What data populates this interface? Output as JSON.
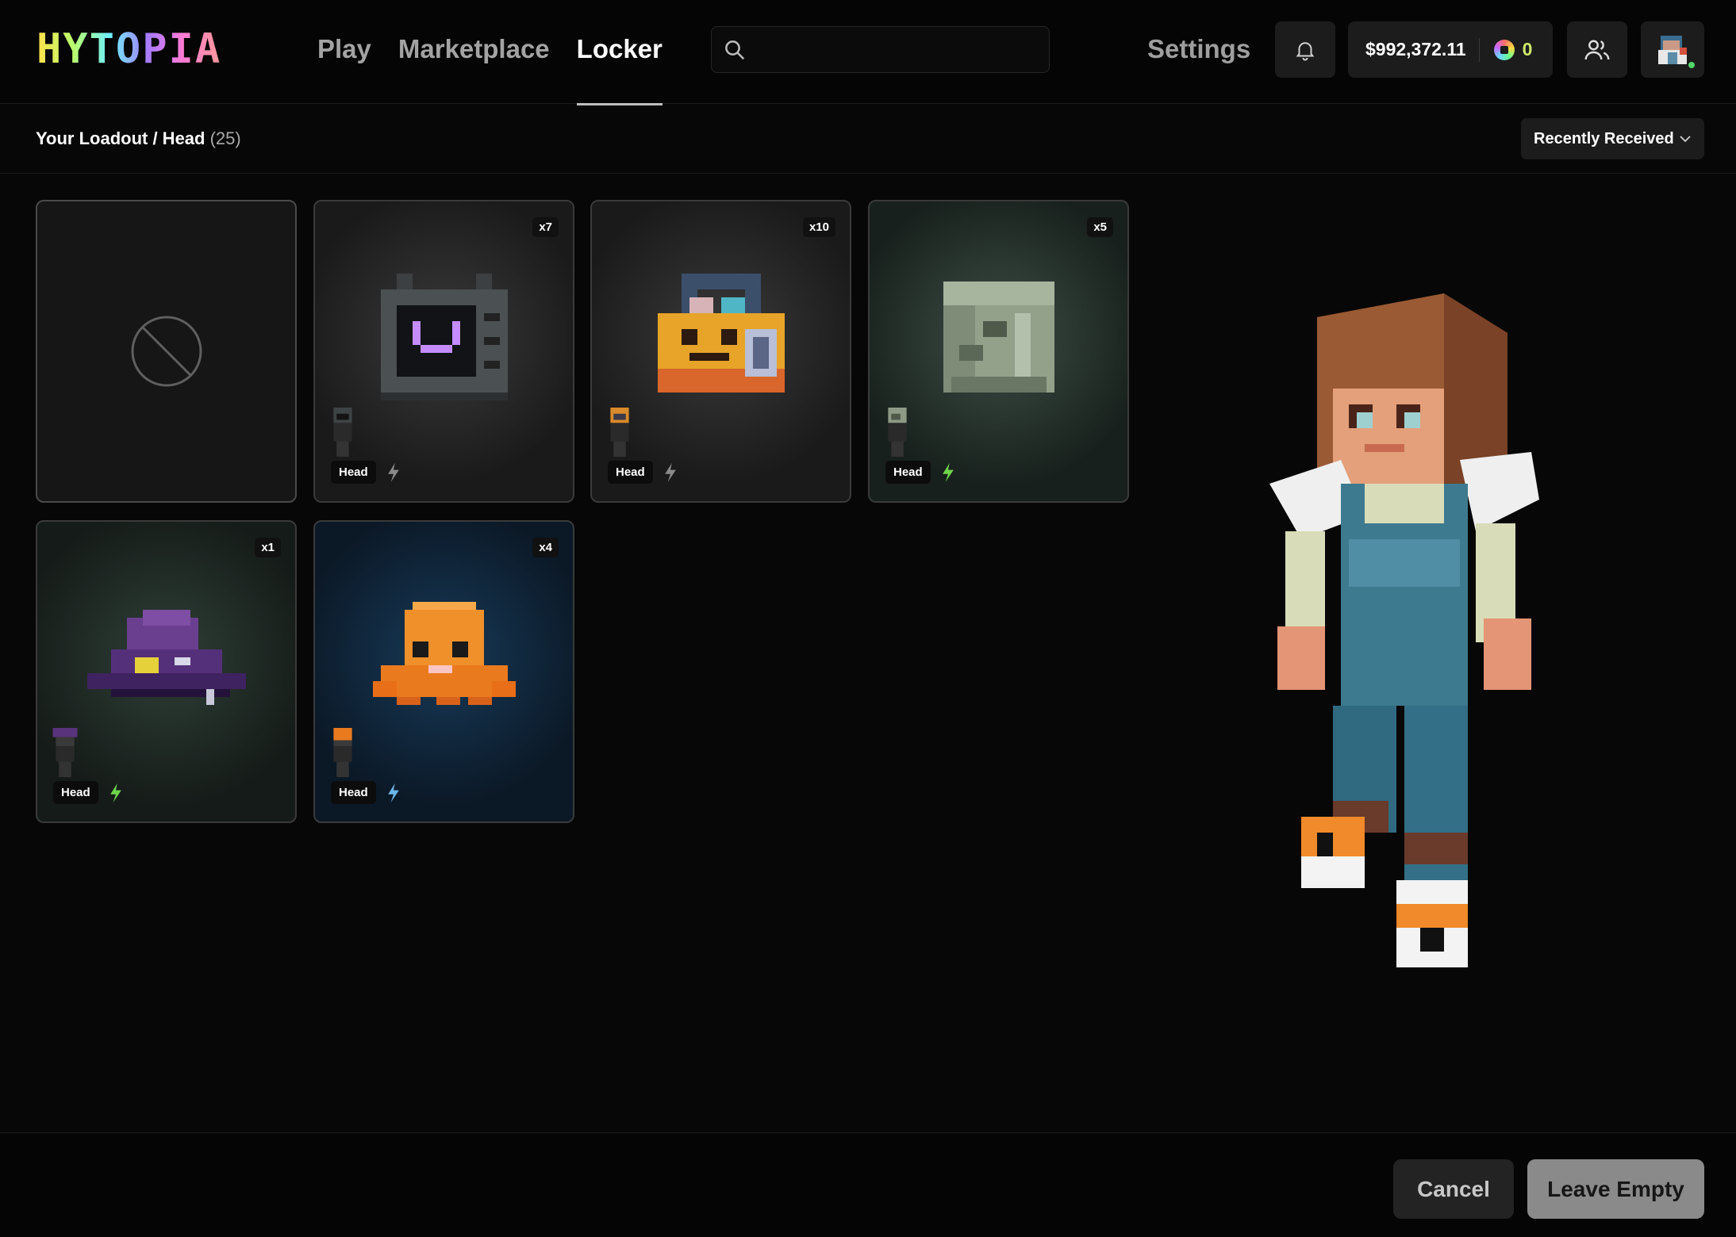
{
  "header": {
    "logo_text": "HYTOPIA",
    "nav": [
      {
        "label": "Play",
        "active": false
      },
      {
        "label": "Marketplace",
        "active": false
      },
      {
        "label": "Locker",
        "active": true
      }
    ],
    "search": {
      "placeholder": "",
      "value": "",
      "icon": "search-icon"
    },
    "settings_label": "Settings",
    "notifications_icon": "bell-icon",
    "wallet": {
      "balance": "$992,372.11",
      "gems": "0"
    },
    "friends_icon": "users-icon",
    "avatar_status": "online"
  },
  "subheader": {
    "breadcrumb": "Your Loadout / Head",
    "count": "(25)",
    "sort_label": "Recently Received"
  },
  "items": [
    {
      "type": "empty",
      "icon": "ban-icon"
    },
    {
      "name": "TV Head",
      "qty": "x7",
      "slot": "Head",
      "bolt": "#8a8a8a"
    },
    {
      "name": "Pumpkin Basket",
      "qty": "x10",
      "slot": "Head",
      "bolt": "#8a8a8a"
    },
    {
      "name": "Stone Helm",
      "qty": "x5",
      "slot": "Head",
      "bolt": "#6fd44a"
    },
    {
      "name": "Purple Hat",
      "qty": "x1",
      "slot": "Head",
      "bolt": "#6fd44a"
    },
    {
      "name": "Orange Octopus",
      "qty": "x4",
      "slot": "Head",
      "bolt": "#6ab7e8"
    }
  ],
  "footer": {
    "cancel_label": "Cancel",
    "leave_label": "Leave Empty"
  },
  "colors": {
    "background": "#070707",
    "panel": "#1c1c1c",
    "accent_green": "#53d86a"
  }
}
